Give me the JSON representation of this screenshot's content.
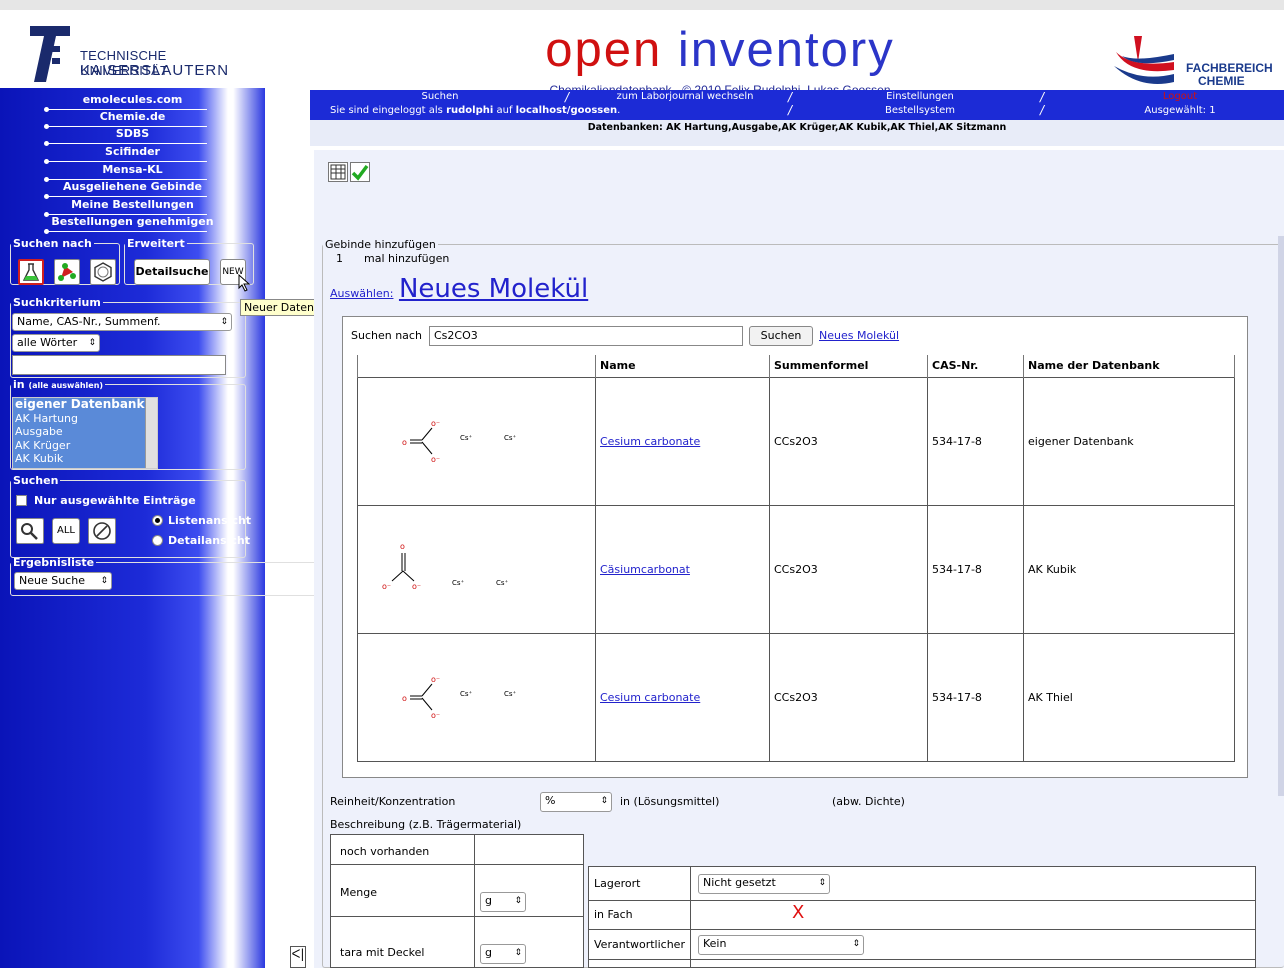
{
  "header": {
    "university_line1": "TECHNISCHE UNIVERSITÄT",
    "university_line2": "KAISERSLAUTERN",
    "title_part1": "open",
    "title_part2": "inventory",
    "subtitle": "Chemikaliendatenbank - © 2010 Felix Rudolphi, Lukas Goossen",
    "department_line1": "FACHBEREICH",
    "department_line2": "CHEMIE"
  },
  "sidebar": {
    "links": [
      "emolecules.com",
      "Chemie.de",
      "SDBS",
      "Scifinder",
      "Mensa-KL",
      "Ausgeliehene Gebinde",
      "Meine Bestellungen",
      "Bestellungen genehmigen"
    ],
    "suchen_nach": "Suchen nach",
    "erweitert": "Erweitert",
    "detailsuche": "Detailsuche",
    "new": "NEW",
    "suchkriterium": "Suchkriterium",
    "criteria_value": "Name, CAS-Nr., Summenf.",
    "words_value": "alle Wörter",
    "in_label": "in",
    "alle_auswaehlen": "(alle auswählen)",
    "databases": [
      "eigener Datenbank",
      "AK Hartung",
      "Ausgabe",
      "AK Krüger",
      "AK Kubik"
    ],
    "suchen": "Suchen",
    "nur_ausgewaehlte": "Nur ausgewählte Einträge",
    "all": "ALL",
    "listenansicht": "Listenansicht",
    "detailansicht": "Detailansicht",
    "ergebnisliste": "Ergebnisliste",
    "ergebnis_value": "Neue Suche"
  },
  "tooltip": "Neuer Datensatz",
  "nav": {
    "items": [
      "Suchen",
      "zum Laborjournal wechseln",
      "Einstellungen"
    ],
    "logout": "Logout",
    "login_prefix": "Sie sind eingeloggt als",
    "user": "rudolphi",
    "login_middle": "auf",
    "host": "localhost/goossen",
    "bestellsystem": "Bestellsystem",
    "ausgewaehlt": "Ausgewählt: 1",
    "datenbanken": "Datenbanken: AK Hartung,Ausgabe,AK Krüger,AK Kubik,AK Thiel,AK Sitzmann"
  },
  "main": {
    "gebinde_legend": "Gebinde hinzufügen",
    "count": "1",
    "mal_hinzufuegen": "mal hinzufügen",
    "auswaehlen": "Auswählen:",
    "neues_molekuel": "Neues Molekül",
    "suchen_nach": "Suchen nach",
    "search_value": "Cs2CO3",
    "suchen_btn": "Suchen"
  },
  "results": {
    "columns": [
      "Name",
      "Summenformel",
      "CAS-Nr.",
      "Name der Datenbank"
    ],
    "rows": [
      {
        "name": "Cesium carbonate",
        "formula": "CCs2O3",
        "cas": "534-17-8",
        "db": "eigener Datenbank"
      },
      {
        "name": "Cäsiumcarbonat",
        "formula": "CCs2O3",
        "cas": "534-17-8",
        "db": "AK Kubik"
      },
      {
        "name": "Cesium carbonate",
        "formula": "CCs2O3",
        "cas": "534-17-8",
        "db": "AK Thiel"
      }
    ]
  },
  "form": {
    "reinheit": "Reinheit/Konzentration",
    "unit_percent": "%",
    "in_loesungsmittel": "in (Lösungsmittel)",
    "abw_dichte": "(abw. Dichte)",
    "beschreibung": "Beschreibung (z.B. Trägermaterial)",
    "noch_vorhanden": "noch vorhanden",
    "menge": "Menge",
    "unit_g": "g",
    "tara": "tara mit Deckel",
    "lagerort": "Lagerort",
    "nicht_gesetzt": "Nicht gesetzt",
    "in_fach": "in Fach",
    "x_mark": "X",
    "verantwortlicher": "Verantwortlicher",
    "kein": "Kein"
  }
}
